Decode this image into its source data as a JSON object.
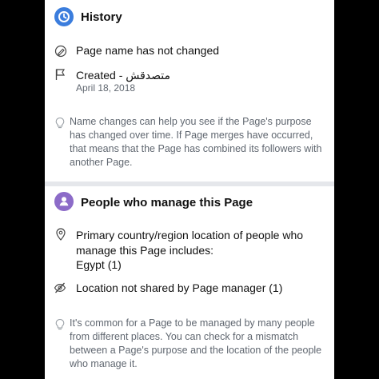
{
  "history": {
    "title": "History",
    "name_status": "Page name has not changed",
    "created_label": "Created - متصدقش",
    "created_date": "April 18, 2018",
    "note": "Name changes can help you see if the Page's purpose has changed over time. If Page merges have occurred, that means that the Page has combined its followers with another Page."
  },
  "managers": {
    "title": "People who manage this Page",
    "location_intro": "Primary country/region location of people who manage this Page includes:",
    "location_value": "Egypt (1)",
    "not_shared": "Location not shared by Page manager (1)",
    "note": "It's common for a Page to be managed by many people from different places. You can check for a mismatch between a Page's purpose and the location of the people who manage it."
  },
  "icons": [
    "clock-icon",
    "edit-icon",
    "flag-icon",
    "lightbulb-icon",
    "people-icon",
    "location-pin-icon",
    "hidden-eye-icon",
    "lightbulb-icon"
  ],
  "colors": {
    "history_icon": "#3b7ddd",
    "people_icon": "#8c6bc8",
    "text": "#111111",
    "muted": "#606770"
  }
}
